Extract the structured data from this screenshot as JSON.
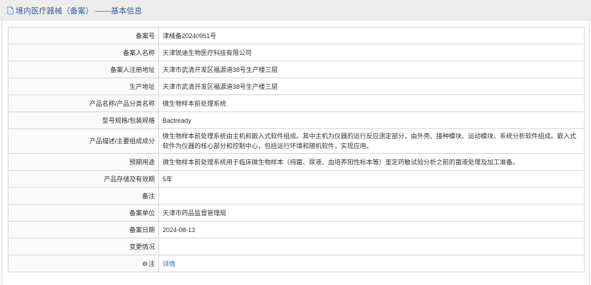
{
  "header": {
    "title": "境内医疗器械（备案） ——基本信息"
  },
  "rows": [
    {
      "label": "备案号",
      "value": "津械备20240951号"
    },
    {
      "label": "备案人名称",
      "value": "天津锐迪生物医疗科技有限公司"
    },
    {
      "label": "备案人注册地址",
      "value": "天津市武清开发区福源道38号生产楼三层"
    },
    {
      "label": "生产地址",
      "value": "天津市武清开发区福源道38号生产楼三层"
    },
    {
      "label": "产品名称/产品分类名称",
      "value": "微生物样本前处理系统"
    },
    {
      "label": "型号规格/包装规格",
      "value": "Bactready"
    },
    {
      "label": "产品描述/主要组成成分",
      "value": "微生物样本前处理系统由主机和嵌入式软件组成。其中主机为仪器的运行反应测定部分，由外壳、接种模块、运动模块、系统分析软件组成。嵌入式软件为仪器的核心部分和控制中心，包括运行环境和随机软件，实现应用。"
    },
    {
      "label": "预期用途",
      "value": "微生物样本前处理系统用于临床微生物样本（纯菌、尿液、血培养阳性标本等）鉴定药敏试验分析之前的菌液处理及加工准备。"
    },
    {
      "label": "产品存储及有效期",
      "value": "5年"
    },
    {
      "label": "备注",
      "value": ""
    },
    {
      "label": "备案单位",
      "value": "天津市药品监督管理局"
    },
    {
      "label": "备案日期",
      "value": "2024-08-13"
    },
    {
      "label": "变更情况",
      "value": ""
    },
    {
      "label": "注",
      "value": "详情",
      "label_icon": "note-icon",
      "is_link": true
    }
  ],
  "colors": {
    "header_bg": "#ededed",
    "title_text": "#3a5f9a",
    "border": "#d6d6d6",
    "link": "#2d6bbf"
  }
}
